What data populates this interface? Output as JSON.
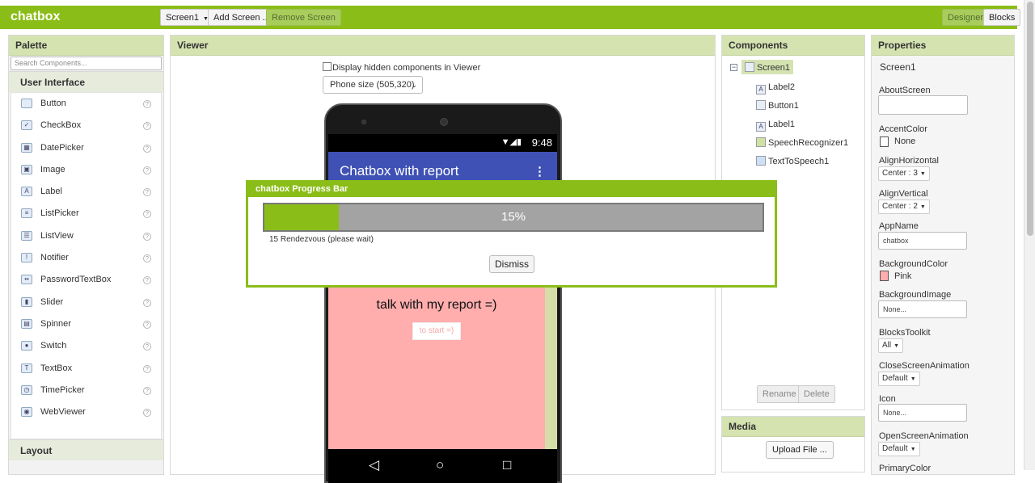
{
  "header": {
    "app_name": "chatbox",
    "screen_select": "Screen1",
    "add_screen": "Add Screen ...",
    "remove_screen": "Remove Screen",
    "designer": "Designer",
    "blocks": "Blocks"
  },
  "palette": {
    "title": "Palette",
    "search_placeholder": "Search Components...",
    "category": "User Interface",
    "items": [
      "Button",
      "CheckBox",
      "DatePicker",
      "Image",
      "Label",
      "ListPicker",
      "ListView",
      "Notifier",
      "PasswordTextBox",
      "Slider",
      "Spinner",
      "Switch",
      "TextBox",
      "TimePicker",
      "WebViewer"
    ],
    "next_category": "Layout",
    "help_glyph": "?"
  },
  "viewer": {
    "title": "Viewer",
    "show_hidden_label": "Display hidden components in Viewer",
    "size_select": "Phone size (505,320)",
    "phone": {
      "time": "9:48",
      "app_title": "Chatbox with report",
      "talk_text": "talk with my report =)",
      "start_button": "to start =)"
    }
  },
  "components": {
    "title": "Components",
    "root": "Screen1",
    "children": [
      "Label2",
      "Button1",
      "Label1",
      "SpeechRecognizer1",
      "TextToSpeech1"
    ],
    "rename": "Rename",
    "delete": "Delete"
  },
  "media": {
    "title": "Media",
    "upload": "Upload File ..."
  },
  "properties": {
    "title": "Properties",
    "component": "Screen1",
    "about_screen_label": "AboutScreen",
    "accent_color_label": "AccentColor",
    "accent_color_value": "None",
    "align_h_label": "AlignHorizontal",
    "align_h_value": "Center : 3",
    "align_v_label": "AlignVertical",
    "align_v_value": "Center : 2",
    "app_name_label": "AppName",
    "app_name_value": "chatbox",
    "bg_color_label": "BackgroundColor",
    "bg_color_value": "Pink",
    "bg_image_label": "BackgroundImage",
    "bg_image_value": "None...",
    "blocks_toolkit_label": "BlocksToolkit",
    "blocks_toolkit_value": "All",
    "close_anim_label": "CloseScreenAnimation",
    "close_anim_value": "Default",
    "icon_label": "Icon",
    "icon_value": "None...",
    "open_anim_label": "OpenScreenAnimation",
    "open_anim_value": "Default",
    "primary_color_label": "PrimaryColor"
  },
  "progress_dialog": {
    "title": "chatbox Progress Bar",
    "percent": 15,
    "percent_text": "15%",
    "status": "15 Rendezvous (please wait)",
    "dismiss": "Dismiss"
  },
  "colors": {
    "accent_green": "#8bbd18",
    "app_bar_blue": "#3f51b5",
    "screen_pink": "#ffadad"
  }
}
